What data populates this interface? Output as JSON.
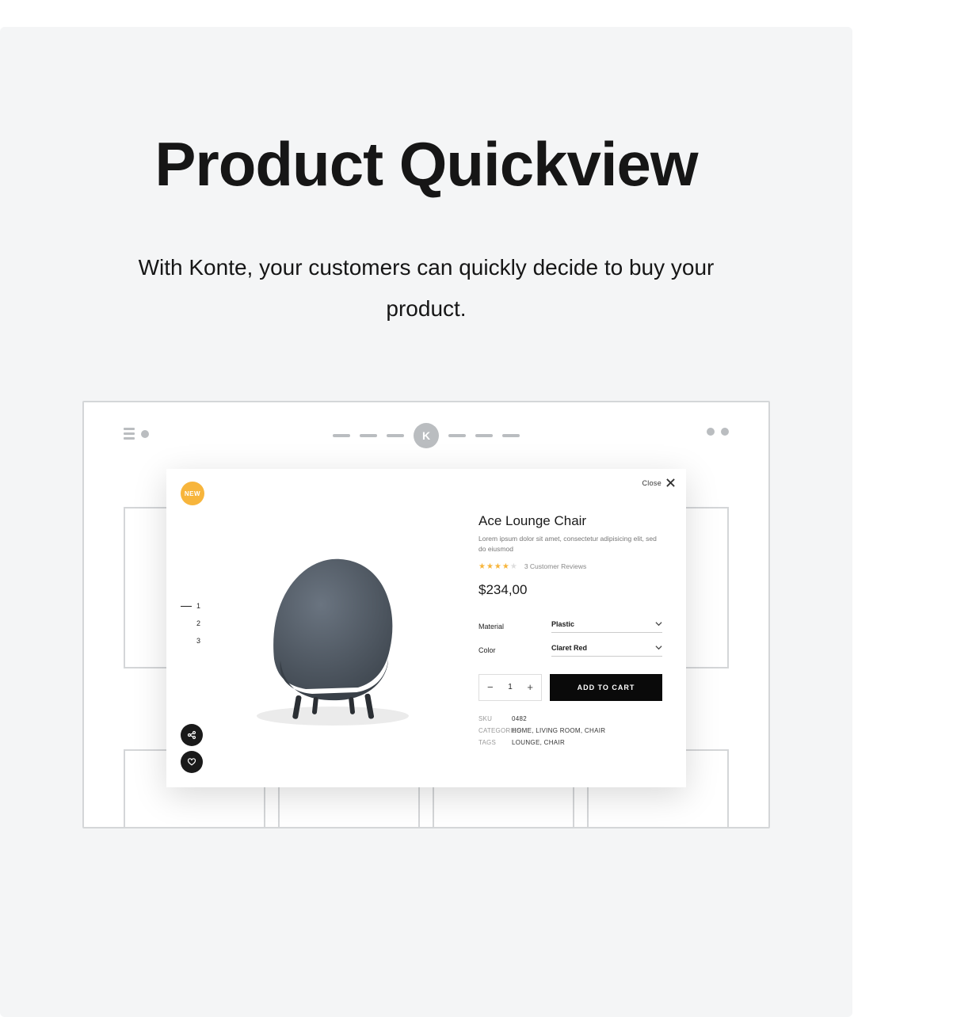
{
  "hero": {
    "title": "Product Quickview",
    "subtitle": "With Konte, your customers can quickly decide to buy your product."
  },
  "wire": {
    "logo_letter": "K"
  },
  "quickview": {
    "badge": "NEW",
    "close_label": "Close",
    "pager": [
      "1",
      "2",
      "3"
    ],
    "pager_active": 0,
    "product": {
      "title": "Ace Lounge Chair",
      "description": "Lorem ipsum dolor sit amet, consectetur adipisicing elit, sed do eiusmod",
      "stars": "★★★★",
      "star_empty": "★",
      "reviews": "3 Customer Reviews",
      "price": "$234,00"
    },
    "options": {
      "material": {
        "label": "Material",
        "value": "Plastic"
      },
      "color": {
        "label": "Color",
        "value": "Claret Red"
      }
    },
    "qty": {
      "value": "1"
    },
    "add_to_cart": "ADD TO CART",
    "meta": {
      "sku": {
        "label": "SKU",
        "value": "0482"
      },
      "categories": {
        "label": "CATEGORIES",
        "value": "HOME, LIVING ROOM, CHAIR"
      },
      "tags": {
        "label": "TAGS",
        "value": "LOUNGE, CHAIR"
      }
    }
  }
}
